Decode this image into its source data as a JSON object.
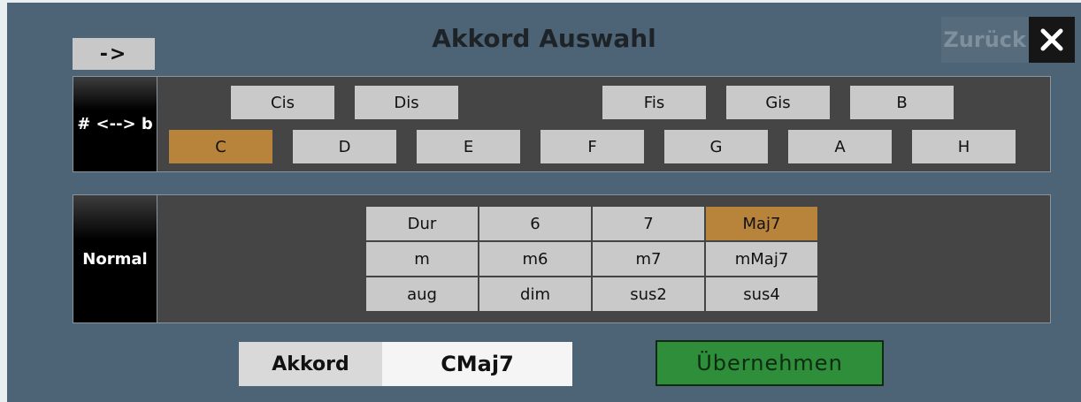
{
  "dialog": {
    "title": "Akkord Auswahl",
    "arrow_label": "->",
    "back_label": "Zurück"
  },
  "roots": {
    "toggle_label": "# <--> b",
    "sharps": [
      {
        "label": "Cis",
        "selected": false
      },
      {
        "label": "Dis",
        "selected": false
      },
      {
        "label": "Fis",
        "selected": false
      },
      {
        "label": "Gis",
        "selected": false
      },
      {
        "label": "B",
        "selected": false
      }
    ],
    "naturals": [
      {
        "label": "C",
        "selected": true
      },
      {
        "label": "D",
        "selected": false
      },
      {
        "label": "E",
        "selected": false
      },
      {
        "label": "F",
        "selected": false
      },
      {
        "label": "G",
        "selected": false
      },
      {
        "label": "A",
        "selected": false
      },
      {
        "label": "H",
        "selected": false
      }
    ]
  },
  "types": {
    "mode_label": "Normal",
    "cells": [
      {
        "label": "Dur",
        "selected": false
      },
      {
        "label": "6",
        "selected": false
      },
      {
        "label": "7",
        "selected": false
      },
      {
        "label": "Maj7",
        "selected": true
      },
      {
        "label": "m",
        "selected": false
      },
      {
        "label": "m6",
        "selected": false
      },
      {
        "label": "m7",
        "selected": false
      },
      {
        "label": "mMaj7",
        "selected": false
      },
      {
        "label": "aug",
        "selected": false
      },
      {
        "label": "dim",
        "selected": false
      },
      {
        "label": "sus2",
        "selected": false
      },
      {
        "label": "sus4",
        "selected": false
      }
    ]
  },
  "result": {
    "label": "Akkord",
    "value": "CMaj7",
    "apply_label": "Übernehmen"
  },
  "colors": {
    "selected": "#b8833a",
    "apply": "#2e8e3a",
    "background": "#4d6476"
  }
}
